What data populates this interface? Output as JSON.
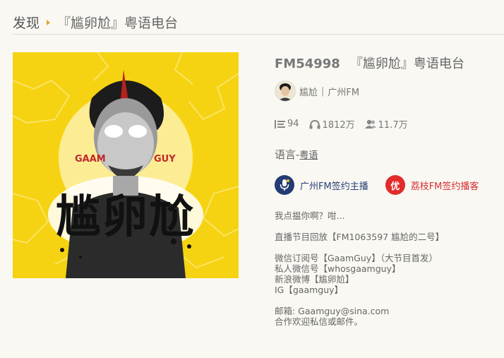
{
  "breadcrumb": {
    "root": "发现",
    "current": "『尴卵尬』粤语电台"
  },
  "cover": {
    "alt": "『尴卵尬』粤语电台 cover",
    "text_left": "GAAM",
    "text_right": "GUY",
    "big_text": "尴卵尬",
    "background": "#f6d312"
  },
  "title": {
    "id": "FM54998",
    "name": "『尴卵尬』粤语电台"
  },
  "author": {
    "name": "尴尬",
    "separator": "|",
    "station": "广州FM"
  },
  "stats": {
    "programs_icon": "playlist-icon",
    "programs": "94",
    "plays_icon": "headphones-icon",
    "plays": "1812万",
    "subscribers_icon": "users-icon",
    "subscribers": "11.7万"
  },
  "language": {
    "label": "语言-",
    "value": "粤语"
  },
  "badges": [
    {
      "icon": "microphone-icon",
      "label": "广州FM签约主播",
      "color": "#243b73"
    },
    {
      "icon_text": "优",
      "label": "荔枝FM签约播客",
      "color": "#e22b2b"
    }
  ],
  "description": [
    "我点揾你啊？咁...",
    "",
    "直播节目回放【FM1063597 尴尬的二号】",
    "",
    "微信订阅号【GaamGuy】（大节目首发）",
    "私人微信号【whosgaamguy】",
    "新浪微博【尴卵尬】",
    "IG【gaamguy】",
    "",
    "邮箱: Gaamguy@sina.com",
    "合作欢迎私信或邮件。"
  ]
}
